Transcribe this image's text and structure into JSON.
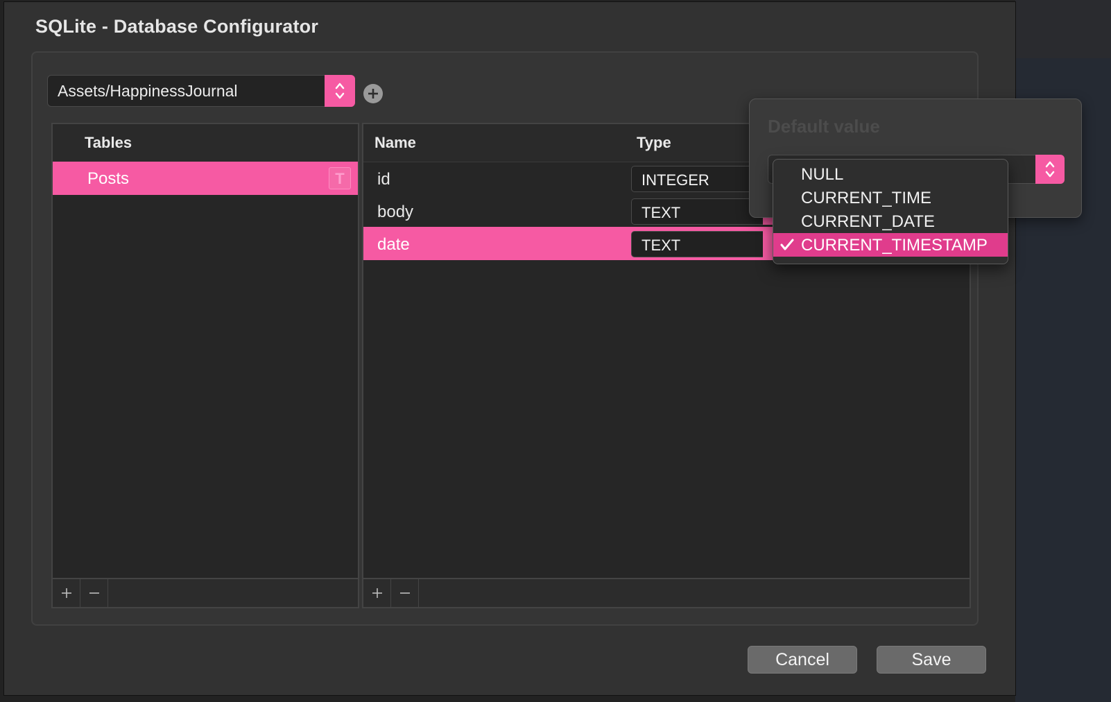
{
  "dialog": {
    "title": "SQLite - Database Configurator"
  },
  "database_selector": {
    "value": "Assets/HappinessJournal"
  },
  "tables_panel": {
    "header": "Tables",
    "rows": [
      {
        "label": "Posts",
        "selected": true,
        "type_icon_letter": "T"
      }
    ]
  },
  "columns_panel": {
    "headers": {
      "name": "Name",
      "type": "Type"
    },
    "rows": [
      {
        "name": "id",
        "type": "INTEGER"
      },
      {
        "name": "body",
        "type": "TEXT"
      },
      {
        "name": "date",
        "type": "TEXT",
        "selected": true
      }
    ]
  },
  "default_value_popover": {
    "label": "Default value",
    "menu_items": [
      {
        "label": "NULL"
      },
      {
        "label": "CURRENT_TIME"
      },
      {
        "label": "CURRENT_DATE"
      },
      {
        "label": "CURRENT_TIMESTAMP",
        "selected": true
      }
    ]
  },
  "footer_buttons": {
    "cancel": "Cancel",
    "save": "Save"
  },
  "icons": {
    "add": "plus-icon",
    "remove": "minus-icon",
    "stepper": "chevron-up-down-icon",
    "check": "checkmark-icon",
    "table": "table-type-icon"
  },
  "colors": {
    "accent": "#f65aa3",
    "menu_highlight": "#e03c8c",
    "window_bg": "#323232",
    "panel_bg": "#262626"
  }
}
